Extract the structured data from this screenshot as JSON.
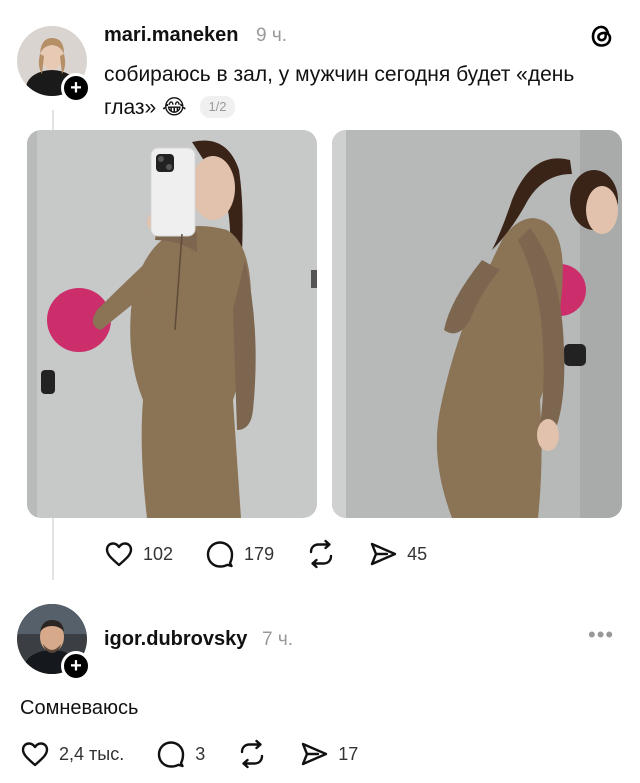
{
  "post": {
    "username": "mari.maneken",
    "time": "9 ч.",
    "text": "собираюсь в зал, у мужчин сегодня будет «день глаз»",
    "emoji": "😂",
    "pager": "1/2",
    "likes": "102",
    "comments": "179",
    "shares": "45"
  },
  "reply": {
    "username": "igor.dubrovsky",
    "time": "7 ч.",
    "text": "Сомневаюсь",
    "likes": "2,4 тыс.",
    "comments": "3",
    "shares": "17"
  },
  "icons": {
    "logo": "threads-logo-icon",
    "like": "heart-icon",
    "comment": "comment-bubble-icon",
    "repost": "repost-icon",
    "share": "send-icon",
    "follow": "plus-icon",
    "more": "more-dots-icon"
  },
  "colors": {
    "accent": "#000000",
    "muted": "#999999",
    "outfit": "#8b7355",
    "background": "#ffffff"
  }
}
